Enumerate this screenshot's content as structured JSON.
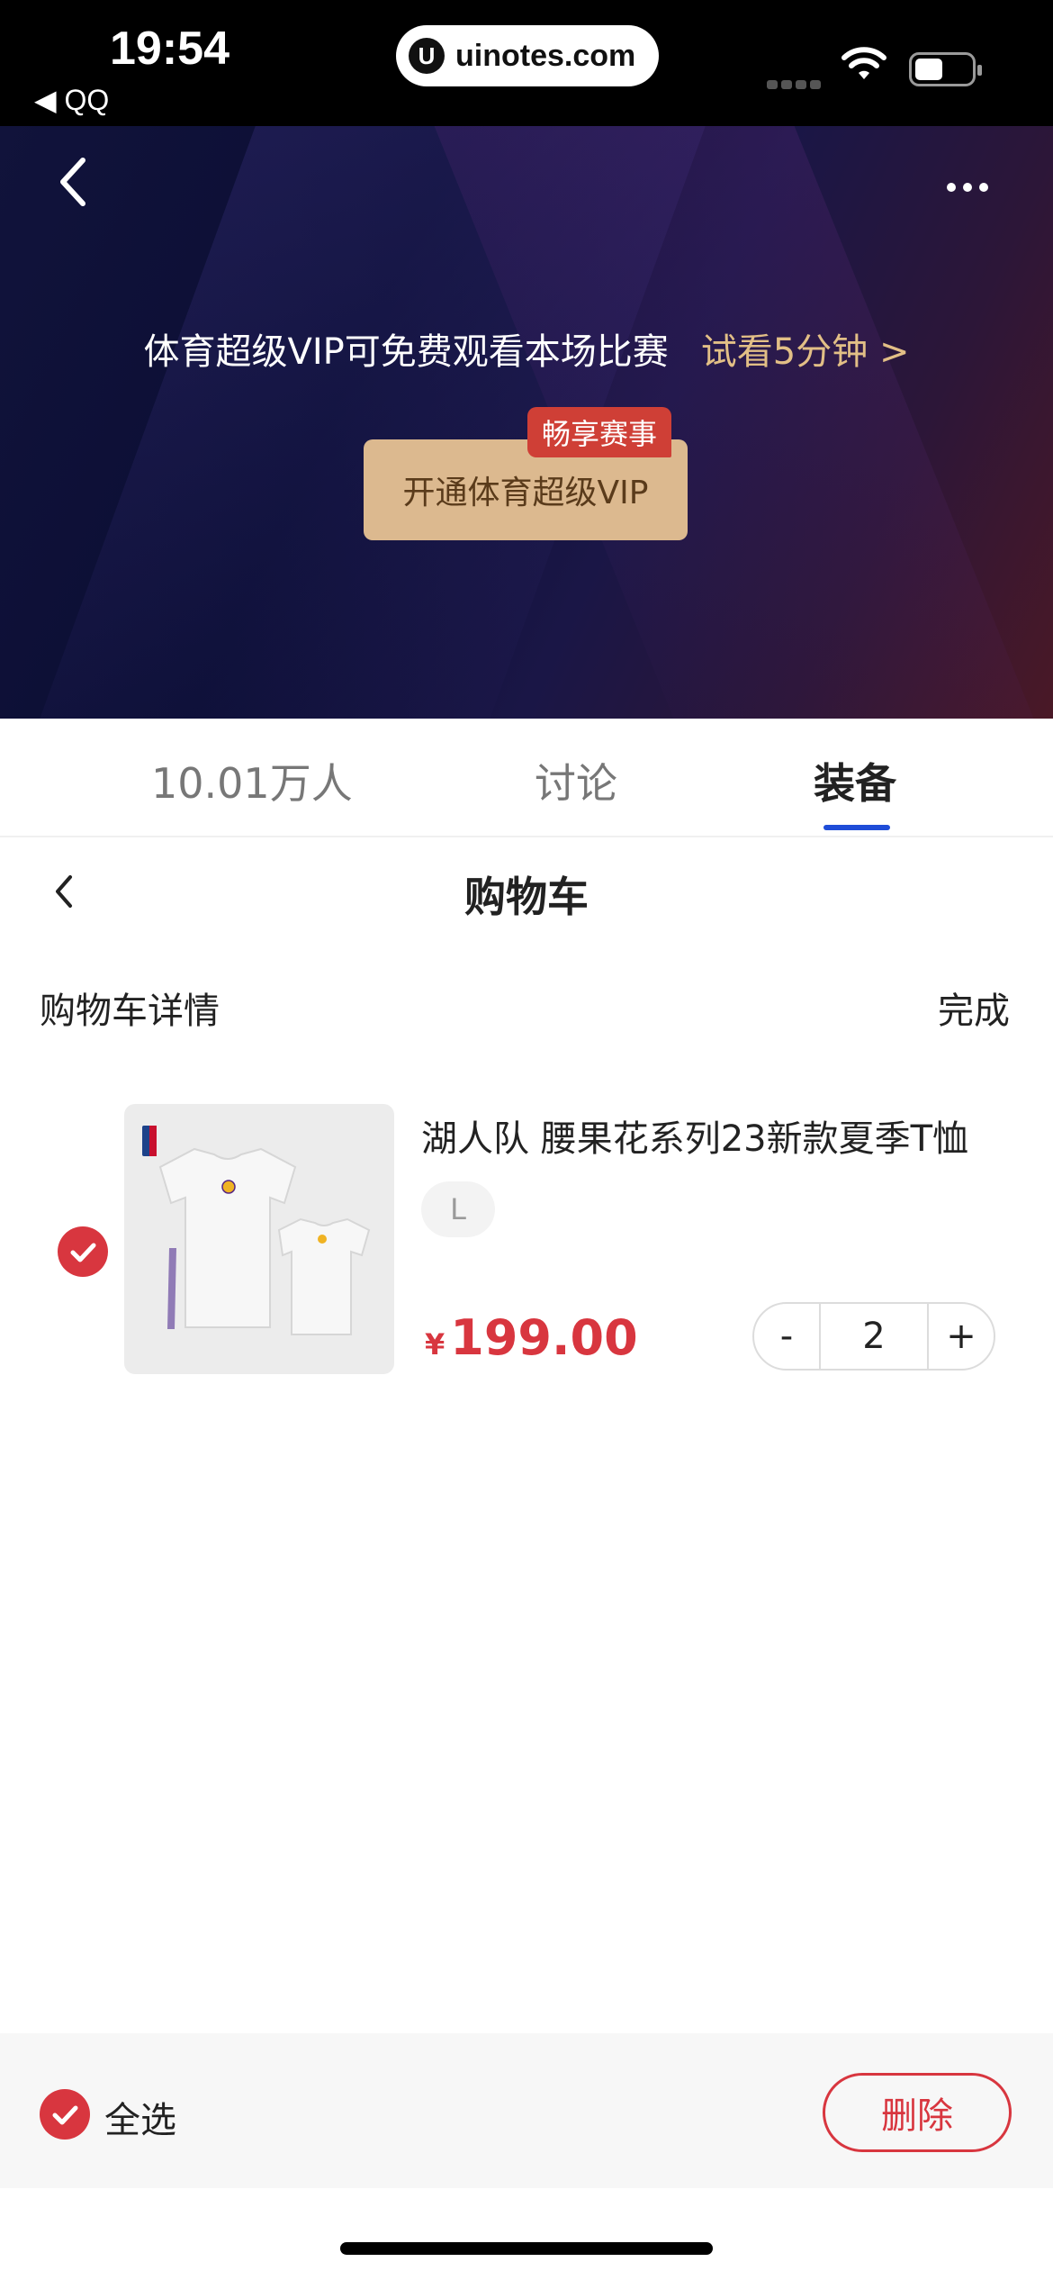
{
  "status_bar": {
    "time": "19:54",
    "back_app": "◀ QQ",
    "url_icon": "U",
    "url": "uinotes.com"
  },
  "video": {
    "message": "体育超级VIP可免费观看本场比赛",
    "trial": "试看5分钟 >",
    "vip_button": "开通体育超级VIP",
    "vip_badge": "畅享赛事"
  },
  "tabs": [
    {
      "label": "10.01万人",
      "active": false
    },
    {
      "label": "讨论",
      "active": false
    },
    {
      "label": "装备",
      "active": true
    }
  ],
  "cart": {
    "title": "购物车",
    "detail_label": "购物车详情",
    "done_label": "完成",
    "items": [
      {
        "title": "湖人队  腰果花系列23新款夏季T恤",
        "spec": "L",
        "currency": "¥",
        "price": "199.00",
        "quantity": "2",
        "minus": "-",
        "plus": "+",
        "checked": true
      }
    ]
  },
  "bottom_bar": {
    "select_all": "全选",
    "delete": "删除"
  },
  "colors": {
    "accent_red": "#d8363f",
    "gold": "#dcb98f",
    "tab_underline": "#1f4dd8"
  }
}
